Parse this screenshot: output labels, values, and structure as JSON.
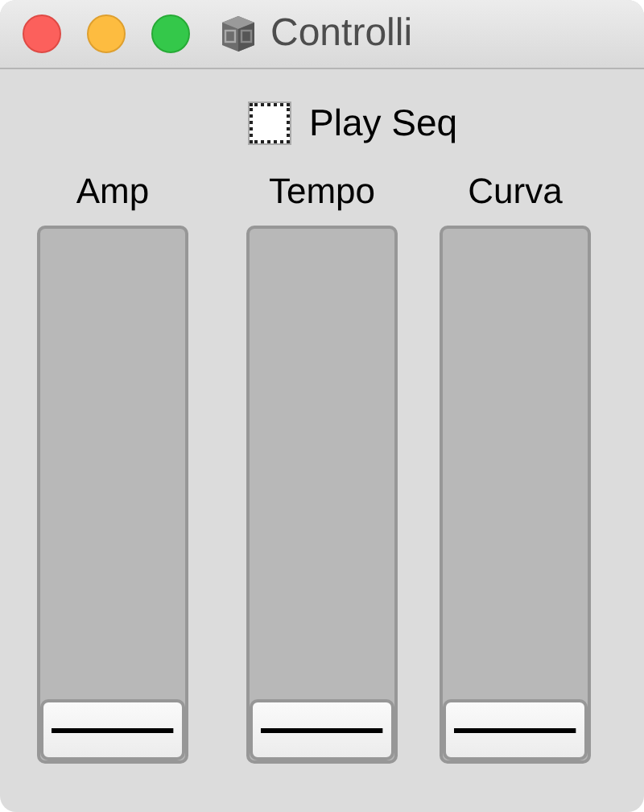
{
  "window": {
    "title": "Controlli"
  },
  "play_seq": {
    "label": "Play Seq",
    "checked": false
  },
  "sliders": [
    {
      "label": "Amp",
      "level": 0
    },
    {
      "label": "Tempo",
      "level": 0
    },
    {
      "label": "Curva",
      "level": 0
    }
  ]
}
